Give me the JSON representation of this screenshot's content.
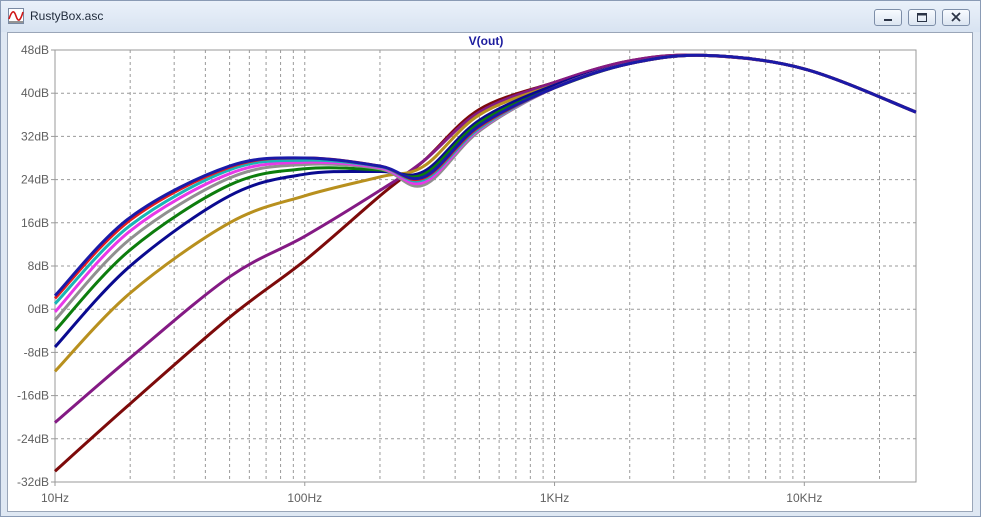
{
  "window": {
    "title": "RustyBox.asc",
    "icon": "waveform-icon",
    "controls": [
      "minimize-icon",
      "restore-icon",
      "close-icon"
    ]
  },
  "colors": {
    "titlebar": "#dfe8f3",
    "grid": "#9a9a9a",
    "axis_text": "#606060",
    "trace_label": "#1b1b9e"
  },
  "chart_data": {
    "type": "line",
    "title": "V(out)",
    "xscale": "log",
    "x_ticks": [
      {
        "value": 10,
        "label": "10Hz"
      },
      {
        "value": 100,
        "label": "100Hz"
      },
      {
        "value": 1000,
        "label": "1KHz"
      },
      {
        "value": 10000,
        "label": "10KHz"
      }
    ],
    "y_ticks": [
      {
        "value": 48,
        "label": "48dB"
      },
      {
        "value": 40,
        "label": "40dB"
      },
      {
        "value": 32,
        "label": "32dB"
      },
      {
        "value": 24,
        "label": "24dB"
      },
      {
        "value": 16,
        "label": "16dB"
      },
      {
        "value": 8,
        "label": "8dB"
      },
      {
        "value": 0,
        "label": "0dB"
      },
      {
        "value": -8,
        "label": "-8dB"
      },
      {
        "value": -16,
        "label": "-16dB"
      },
      {
        "value": -24,
        "label": "-24dB"
      },
      {
        "value": -32,
        "label": "-32dB"
      }
    ],
    "xlim": [
      10,
      28000
    ],
    "ylim": [
      -32,
      48
    ],
    "grid": true,
    "x": [
      10,
      20,
      50,
      100,
      200,
      300,
      500,
      1000,
      2000,
      4000,
      10000,
      28000
    ],
    "series": [
      {
        "color": "#1a1aa8",
        "values": [
          2.5,
          17,
          26.5,
          28,
          26.5,
          24.5,
          34,
          41,
          45.5,
          47,
          44.5,
          36.5
        ]
      },
      {
        "color": "#e51c1c",
        "values": [
          2,
          16.5,
          26.3,
          28,
          26.5,
          24.3,
          33.8,
          41,
          45.5,
          47,
          44.5,
          36.5
        ]
      },
      {
        "color": "#18b5b5",
        "values": [
          1,
          15.5,
          25.8,
          27.6,
          26.4,
          24,
          33.5,
          41,
          45.5,
          47,
          44.5,
          36.5
        ]
      },
      {
        "color": "#e838e8",
        "values": [
          -0.5,
          14.5,
          25.1,
          27.2,
          26.2,
          23.5,
          33.3,
          41,
          45.5,
          47,
          44.5,
          36.5
        ]
      },
      {
        "color": "#909090",
        "values": [
          -2,
          13,
          24.3,
          26.8,
          26,
          23,
          33,
          41,
          45.5,
          47,
          44.5,
          36.5
        ]
      },
      {
        "color": "#0d7d0d",
        "values": [
          -4,
          11,
          23,
          26,
          25.8,
          25,
          34.5,
          41,
          45.5,
          47,
          44.5,
          36.5
        ]
      },
      {
        "color": "#0a0a90",
        "values": [
          -7,
          8,
          21,
          25,
          25.5,
          25.5,
          35,
          41.5,
          45.5,
          47,
          44.5,
          36.5
        ]
      },
      {
        "color": "#b8901e",
        "values": [
          -11.5,
          3,
          16,
          21,
          24.5,
          26.5,
          36,
          41.5,
          45.5,
          47,
          44.5,
          36.5
        ]
      },
      {
        "color": "#841a84",
        "values": [
          -21,
          -9,
          6,
          13.5,
          22,
          27.5,
          36.5,
          42,
          46,
          47,
          44.5,
          36.5
        ]
      },
      {
        "color": "#7d0a0a",
        "values": [
          -30,
          -17.5,
          -1.5,
          9,
          21,
          27.5,
          37,
          42,
          46,
          47,
          44.5,
          36.5
        ]
      }
    ]
  }
}
